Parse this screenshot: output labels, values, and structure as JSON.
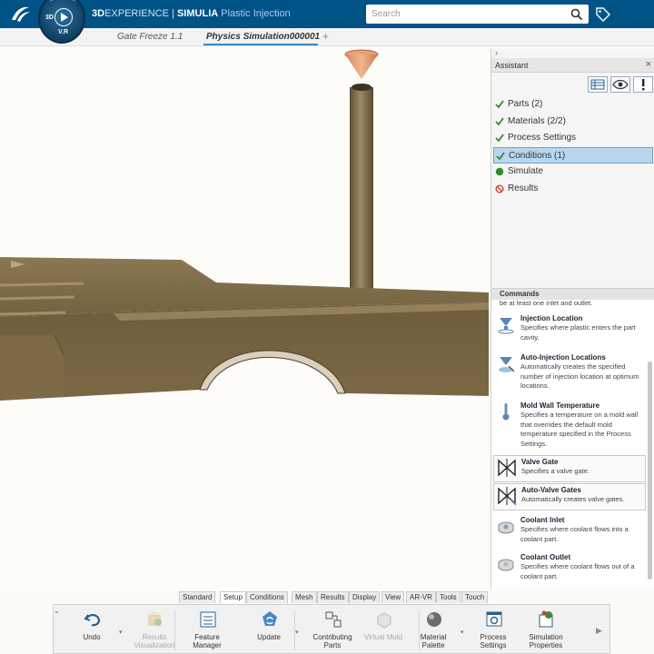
{
  "topbar": {
    "brand": "3D",
    "title_brand": "EXPERIENCE",
    "title_sep": "|",
    "title_product": "SIMULIA",
    "title_app": "Plastic Injection",
    "compass_3d": "3D",
    "compass_vr": "V.R",
    "search_placeholder": "Search"
  },
  "tabs": [
    {
      "label": "Gate Freeze 1.1"
    },
    {
      "label": "Physics Simulation000001"
    }
  ],
  "tab_add": "+",
  "assistant": {
    "title": "Assistant",
    "collapse": "›",
    "close": "×",
    "workflow": [
      {
        "label": "Parts (2)",
        "state": "done"
      },
      {
        "label": "Materials (2/2)",
        "state": "done"
      },
      {
        "label": "Process Settings",
        "state": "done"
      },
      {
        "label": "Conditions (1)",
        "state": "active"
      },
      {
        "label": "Simulate",
        "state": "ready"
      },
      {
        "label": "Results",
        "state": "blocked"
      }
    ]
  },
  "commands": {
    "title": "Commands",
    "top_text": "be at least one inlet and outlet.",
    "items": [
      {
        "title": "Injection Location",
        "desc": "Specifies where plastic enters the part cavity.",
        "icon": "injection-location-icon"
      },
      {
        "title": "Auto-Injection Locations",
        "desc": "Automatically creates the specified number of injection location at optimum locations.",
        "icon": "auto-injection-icon"
      },
      {
        "title": "Mold Wall Temperature",
        "desc": "Specifies a temperature on a mold wall that overrides the default mold temperature specified in the Process Settings.",
        "icon": "thermometer-icon"
      },
      {
        "title": "Valve Gate",
        "desc": "Specifies a valve gate.",
        "icon": "valve-gate-icon"
      },
      {
        "title": "Auto-Valve Gates",
        "desc": "Automatically creates valve gates.",
        "icon": "auto-valve-icon"
      },
      {
        "title": "Coolant Inlet",
        "desc": "Specifies where coolant flows into a coolant part.",
        "icon": "coolant-inlet-icon"
      },
      {
        "title": "Coolant Outlet",
        "desc": "Specifies where coolant flows out of a coolant part.",
        "icon": "coolant-outlet-icon"
      }
    ]
  },
  "action_tabs": [
    "Standard",
    "Setup",
    "Conditions",
    "Mesh",
    "Results",
    "Display",
    "View",
    "AR-VR",
    "Tools",
    "Touch"
  ],
  "action_bar": [
    {
      "label": "Undo",
      "icon": "undo-icon",
      "enabled": true
    },
    {
      "label": "Results Visualization",
      "icon": "results-visualization-icon",
      "enabled": false
    },
    {
      "label": "Feature Manager",
      "icon": "feature-manager-icon",
      "enabled": true
    },
    {
      "label": "Update",
      "icon": "update-icon",
      "enabled": true
    },
    {
      "label": "Contributing Parts",
      "icon": "contributing-parts-icon",
      "enabled": true
    },
    {
      "label": "Virtual Mold",
      "icon": "virtual-mold-icon",
      "enabled": false
    },
    {
      "label": "Material Palette",
      "icon": "material-palette-icon",
      "enabled": true
    },
    {
      "label": "Process Settings",
      "icon": "process-settings-icon",
      "enabled": true
    },
    {
      "label": "Simulation Properties",
      "icon": "simulation-properties-icon",
      "enabled": true
    }
  ],
  "colors": {
    "topbar": "#005386",
    "part": "#7c6a48",
    "active_item": "#b8d7ef",
    "check": "#3a8a2f"
  }
}
